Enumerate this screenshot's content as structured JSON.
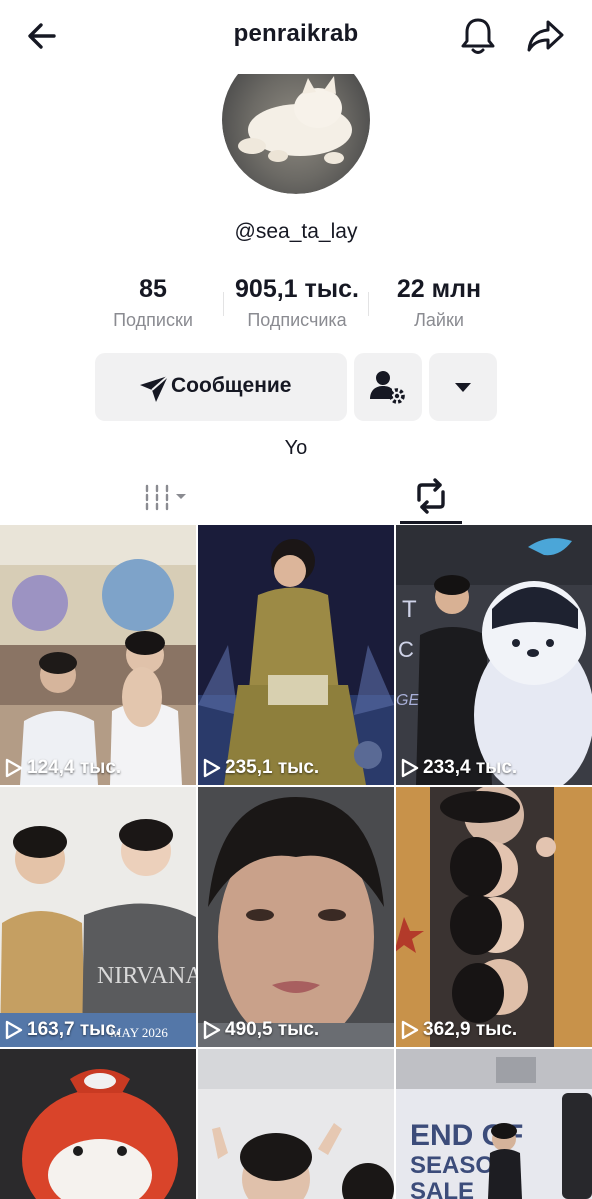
{
  "header": {
    "title": "penraikrab"
  },
  "profile": {
    "username": "@sea_ta_lay",
    "bio": "Yo"
  },
  "stats": [
    {
      "value": "85",
      "label": "Подписки"
    },
    {
      "value": "905,1 тыс.",
      "label": "Подписчика"
    },
    {
      "value": "22 млн",
      "label": "Лайки"
    }
  ],
  "actions": {
    "message_label": "Сообщение"
  },
  "videos": [
    {
      "views": "124,4 тыс."
    },
    {
      "views": "235,1 тыс."
    },
    {
      "views": "233,4 тыс."
    },
    {
      "views": "163,7 тыс."
    },
    {
      "views": "490,5 тыс."
    },
    {
      "views": "362,9 тыс."
    },
    {
      "views": ""
    },
    {
      "views": ""
    },
    {
      "views": ""
    }
  ],
  "thumbnail_texts": {
    "video_3_sign": "T C GE",
    "video_4_shirt": "NIRVANA",
    "video_4_card": "MAY 2026",
    "video_9_banner": "END OF SEASON SALE"
  },
  "colors": {
    "text": "#161823",
    "secondary": "#8a8b91",
    "button_bg": "#f1f1f2"
  }
}
